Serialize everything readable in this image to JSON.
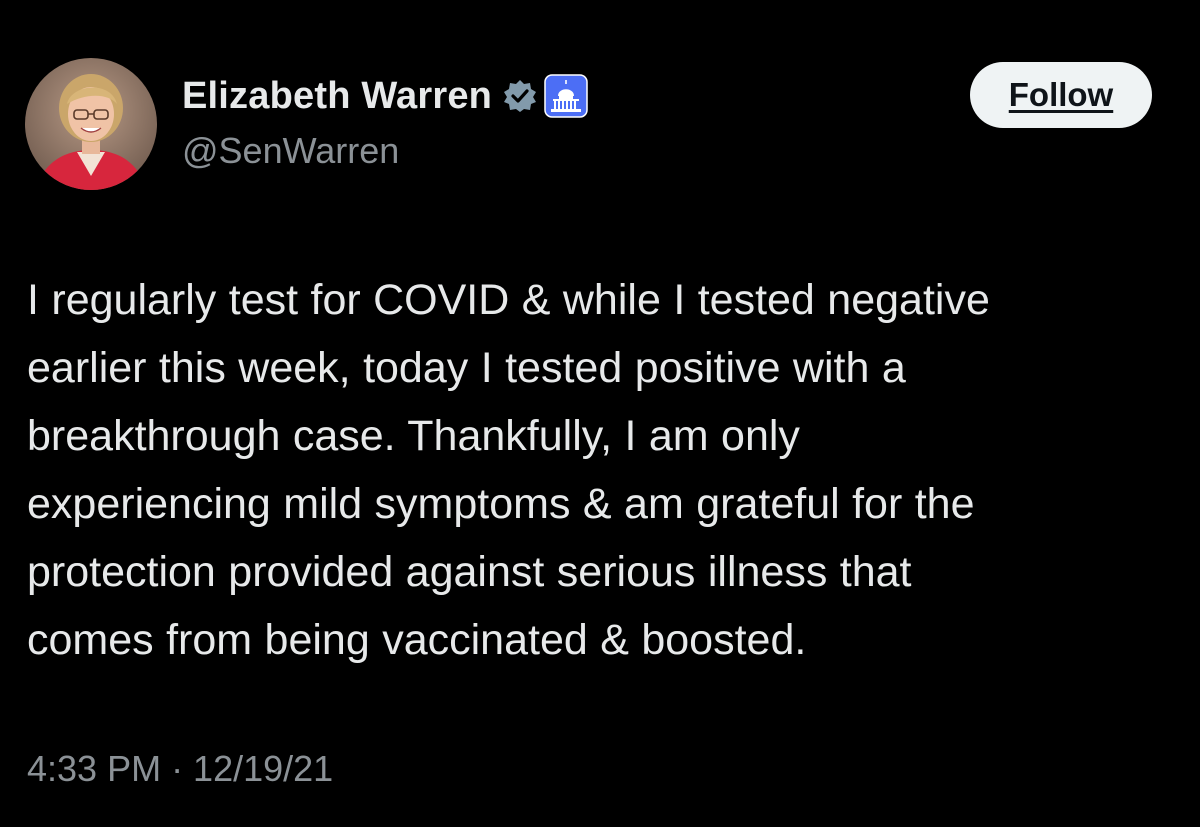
{
  "author": {
    "display_name": "Elizabeth Warren",
    "handle": "@SenWarren",
    "avatar_icon": "profile-photo",
    "badges": [
      "verified-badge-icon",
      "us-government-capitol-icon"
    ]
  },
  "follow_button": {
    "label": "Follow"
  },
  "tweet": {
    "lines": [
      "I regularly test for COVID & while I tested negative",
      "earlier this week, today I tested positive with a",
      "breakthrough case. Thankfully, I am only",
      "experiencing mild symptoms & am grateful for the",
      "protection provided against serious illness that",
      "comes from being vaccinated & boosted."
    ],
    "timestamp": "4:33 PM · 12/19/21"
  },
  "colors": {
    "background": "#000000",
    "primary_text": "#e7e9ea",
    "secondary_text": "#8b9196",
    "follow_bg": "#eff3f4",
    "verified_badge": "#829aab",
    "gov_badge": "#4c6ef5"
  }
}
